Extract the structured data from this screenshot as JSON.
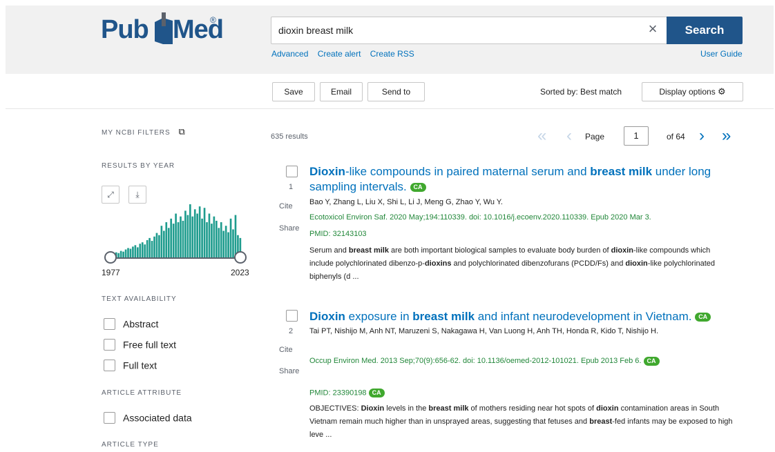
{
  "header": {
    "logo_pub": "Pub",
    "logo_med": "Med",
    "logo_reg": "®",
    "search_value": "dioxin breast milk",
    "search_button": "Search",
    "clear_icon": "close-icon",
    "links": [
      "Advanced",
      "Create alert",
      "Create RSS"
    ],
    "user_guide": "User Guide"
  },
  "toolbar": {
    "save": "Save",
    "email": "Email",
    "send_to": "Send to",
    "sorted_by": "Sorted by: Best match",
    "display_options": "Display options",
    "gear_icon": "gear-icon"
  },
  "sidebar": {
    "my_ncbi_filters": "MY NCBI FILTERS",
    "results_by_year": "RESULTS BY YEAR",
    "year_start": "1977",
    "year_end": "2023",
    "text_availability": "TEXT AVAILABILITY",
    "text_options": [
      "Abstract",
      "Free full text",
      "Full text"
    ],
    "article_attribute": "ARTICLE ATTRIBUTE",
    "attribute_options": [
      "Associated data"
    ],
    "article_type": "ARTICLE TYPE",
    "bar_color": "#1f9c8e",
    "year_bars": [
      0.05,
      0.06,
      0.08,
      0.07,
      0.1,
      0.09,
      0.12,
      0.14,
      0.13,
      0.16,
      0.18,
      0.15,
      0.2,
      0.22,
      0.19,
      0.25,
      0.28,
      0.24,
      0.3,
      0.35,
      0.32,
      0.45,
      0.38,
      0.5,
      0.42,
      0.55,
      0.48,
      0.62,
      0.5,
      0.58,
      0.52,
      0.66,
      0.6,
      0.75,
      0.58,
      0.68,
      0.62,
      0.72,
      0.55,
      0.7,
      0.5,
      0.62,
      0.48,
      0.58,
      0.52,
      0.42,
      0.5,
      0.38,
      0.45,
      0.36,
      0.55,
      0.4,
      0.6,
      0.32,
      0.28
    ]
  },
  "results": {
    "count_text": "635 results",
    "page_label": "Page",
    "page_value": "1",
    "of_pages": "of 64",
    "items": [
      {
        "num": "1",
        "title_parts": [
          {
            "t": "Dioxin",
            "b": true
          },
          {
            "t": "-like compounds in paired maternal serum and ",
            "b": false
          },
          {
            "t": "breast milk",
            "b": true
          },
          {
            "t": " under long sampling intervals. ",
            "b": false
          }
        ],
        "badge": "CA",
        "authors": "Bao Y, Zhang L, Liu X, Shi L, Li J, Meng G, Zhao Y, Wu Y.",
        "journal": "Ecotoxicol Environ Saf. 2020 May;194:110339. doi: 10.1016/j.ecoenv.2020.110339. Epub 2020 Mar 3.",
        "pmid": "PMID: 32143103",
        "snippet_parts": [
          {
            "t": "Serum and ",
            "b": false
          },
          {
            "t": "breast milk",
            "b": true
          },
          {
            "t": " are both important biological samples to evaluate body burden of ",
            "b": false
          },
          {
            "t": "dioxin",
            "b": true
          },
          {
            "t": "-like compounds which include polychlorinated dibenzo-p-",
            "b": false
          },
          {
            "t": "dioxins",
            "b": true
          },
          {
            "t": " and polychlorinated dibenzofurans (PCDD/Fs) and ",
            "b": false
          },
          {
            "t": "dioxin",
            "b": true
          },
          {
            "t": "-like polychlorinated biphenyls (d ...",
            "b": false
          }
        ],
        "cite": "Cite",
        "share": "Share"
      },
      {
        "num": "2",
        "title_parts": [
          {
            "t": "Dioxin",
            "b": true
          },
          {
            "t": " exposure in ",
            "b": false
          },
          {
            "t": "breast milk",
            "b": true
          },
          {
            "t": " and infant neurodevelopment in Vietnam. ",
            "b": false
          }
        ],
        "badge": "CA",
        "authors": "Tai PT, Nishijo M, Anh NT, Maruzeni S, Nakagawa H, Van Luong H, Anh TH, Honda R, Kido T, Nishijo H.",
        "journal": "Occup Environ Med. 2013 Sep;70(9):656-62. doi: 10.1136/oemed-2012-101021. Epub 2013 Feb 6.",
        "pmid": "PMID: 23390198",
        "snippet_parts": [
          {
            "t": "OBJECTIVES: ",
            "b": false
          },
          {
            "t": "Dioxin",
            "b": true
          },
          {
            "t": " levels in the ",
            "b": false
          },
          {
            "t": "breast milk",
            "b": true
          },
          {
            "t": " of mothers residing near hot spots of ",
            "b": false
          },
          {
            "t": "dioxin",
            "b": true
          },
          {
            "t": " contamination areas in South Vietnam remain much higher than in unsprayed areas, suggesting that fetuses and ",
            "b": false
          },
          {
            "t": "breast",
            "b": true
          },
          {
            "t": "-fed infants may be exposed to high leve ...",
            "b": false
          }
        ],
        "cite": "Cite",
        "share": "Share"
      }
    ]
  }
}
